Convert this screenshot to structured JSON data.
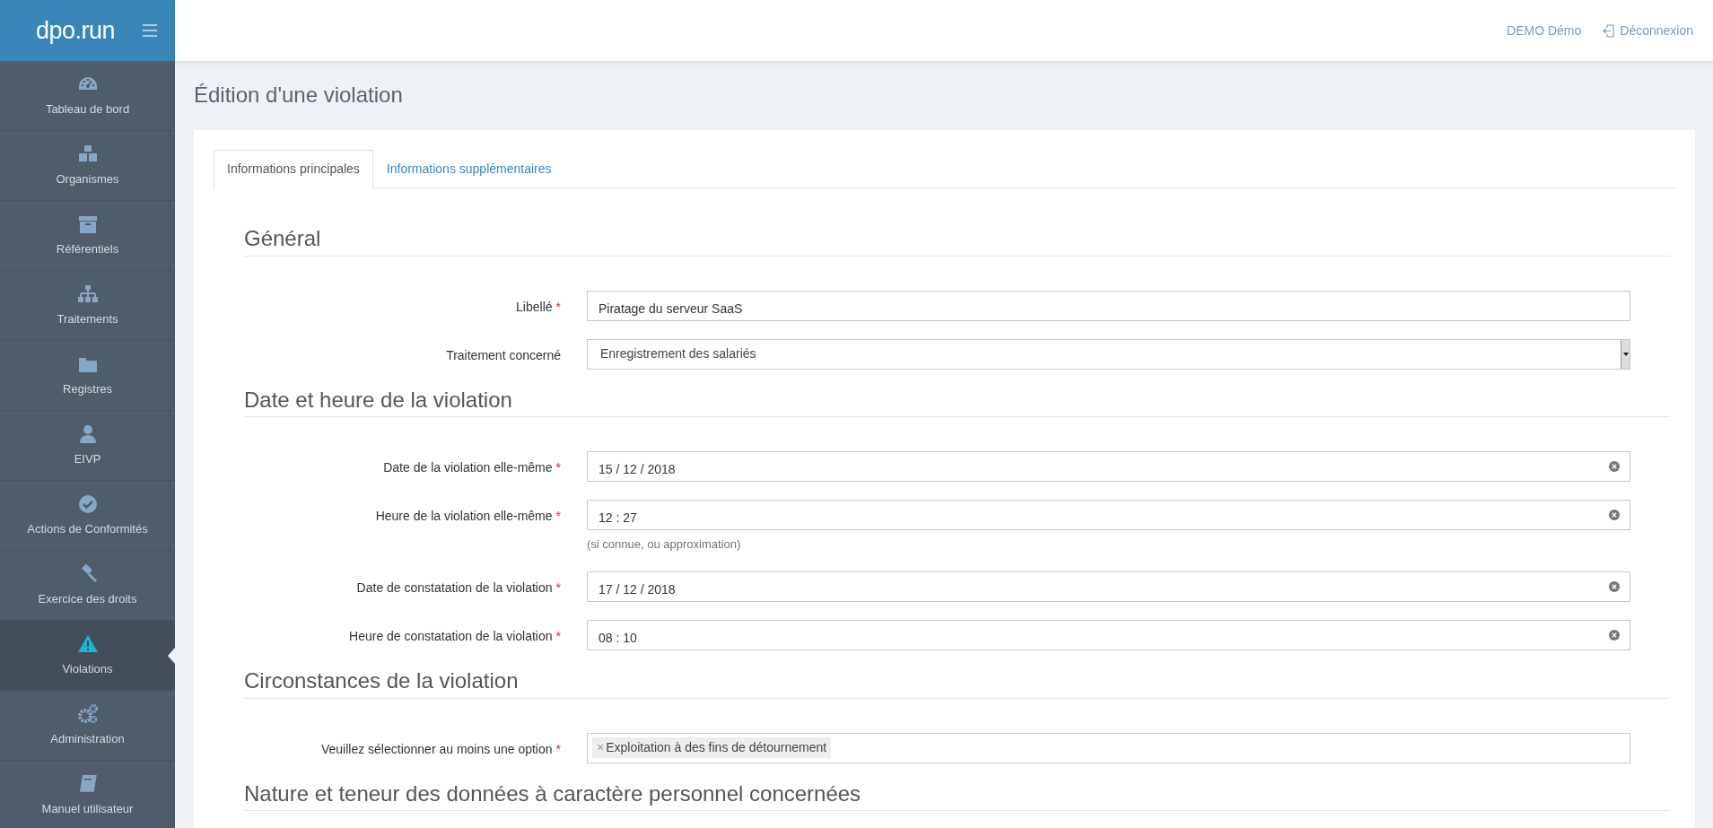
{
  "brand": {
    "logo": "dpo.run"
  },
  "sidebar": {
    "items": [
      {
        "label": "Tableau de bord",
        "selected": false
      },
      {
        "label": "Organismes",
        "selected": false
      },
      {
        "label": "Référentiels",
        "selected": false
      },
      {
        "label": "Traitements",
        "selected": false
      },
      {
        "label": "Registres",
        "selected": false
      },
      {
        "label": "EIVP",
        "selected": false
      },
      {
        "label": "Actions de Conformités",
        "selected": false
      },
      {
        "label": "Exercice des droits",
        "selected": false
      },
      {
        "label": "Violations",
        "selected": true
      },
      {
        "label": "Administration",
        "selected": false
      },
      {
        "label": "Manuel utilisateur",
        "selected": false
      }
    ]
  },
  "topbar": {
    "user": "DEMO Démo",
    "logout": "Déconnexion"
  },
  "page_title": "Édition d'une violation",
  "tabs": [
    {
      "label": "Informations principales",
      "selected": true
    },
    {
      "label": "Informations supplémentaires",
      "selected": false
    }
  ],
  "sections": [
    {
      "title": "Général",
      "fields": [
        {
          "kind": "text",
          "label": "Libellé",
          "required_mark": "*",
          "value": "Piratage du serveur SaaS"
        },
        {
          "kind": "select",
          "label": "Traitement concerné",
          "value": "Enregistrement des salariés"
        }
      ]
    },
    {
      "title": "Date et heure de la violation",
      "fields": [
        {
          "kind": "clearable",
          "label": "Date de la violation elle-même",
          "required_mark": "*",
          "value": "15 / 12 / 2018"
        },
        {
          "kind": "clearable",
          "label": "Heure de la violation elle-même",
          "required_mark": "*",
          "value": "12 : 27",
          "help": "(si connue, ou approximation)"
        },
        {
          "kind": "clearable",
          "label": "Date de constatation de la violation",
          "required_mark": "*",
          "value": "17 / 12 / 2018"
        },
        {
          "kind": "clearable",
          "label": "Heure de constatation de la violation",
          "required_mark": "*",
          "value": "08 : 10"
        }
      ]
    },
    {
      "title": "Circonstances de la violation",
      "fields": [
        {
          "kind": "tags",
          "label": "Veuillez sélectionner au moins une option",
          "required_mark": "*",
          "tags": [
            {
              "remove": "×",
              "label": "Exploitation à des fins de détournement"
            }
          ]
        }
      ]
    },
    {
      "title": "Nature et teneur des données à caractère personnel concernées"
    }
  ]
}
